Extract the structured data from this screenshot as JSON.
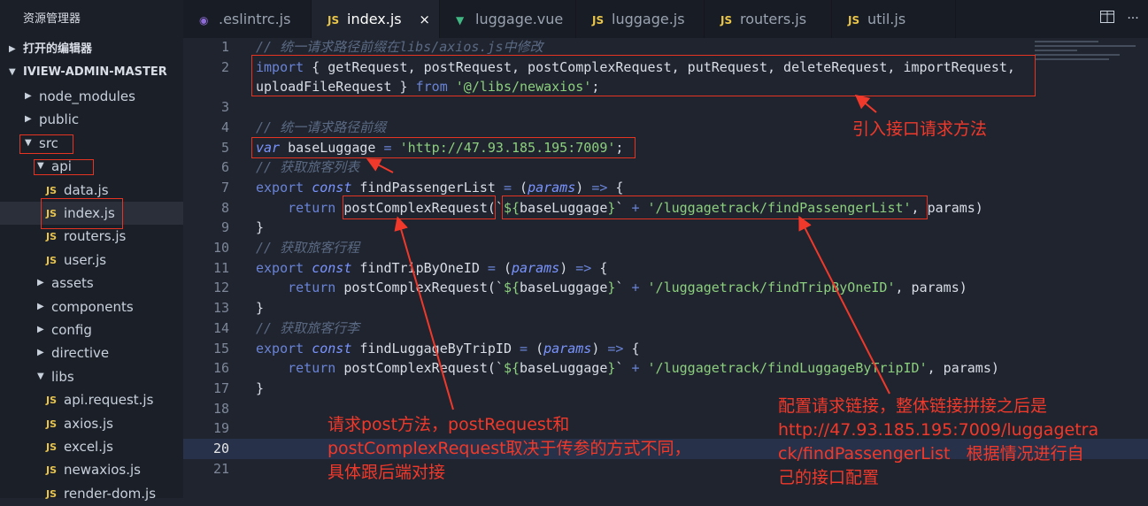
{
  "explorer": {
    "title": "资源管理器",
    "open_editors": "打开的编辑器",
    "project": "IVIEW-ADMIN-MASTER",
    "items": [
      {
        "label": "node_modules",
        "type": "folder",
        "expanded": false,
        "depth": 1
      },
      {
        "label": "public",
        "type": "folder",
        "expanded": false,
        "depth": 1
      },
      {
        "label": "src",
        "type": "folder",
        "expanded": true,
        "depth": 1
      },
      {
        "label": "api",
        "type": "folder",
        "expanded": true,
        "depth": 2
      },
      {
        "label": "data.js",
        "type": "js",
        "depth": 3
      },
      {
        "label": "index.js",
        "type": "js",
        "depth": 3,
        "selected": true
      },
      {
        "label": "routers.js",
        "type": "js",
        "depth": 3
      },
      {
        "label": "user.js",
        "type": "js",
        "depth": 3
      },
      {
        "label": "assets",
        "type": "folder",
        "expanded": false,
        "depth": 2
      },
      {
        "label": "components",
        "type": "folder",
        "expanded": false,
        "depth": 2
      },
      {
        "label": "config",
        "type": "folder",
        "expanded": false,
        "depth": 2
      },
      {
        "label": "directive",
        "type": "folder",
        "expanded": false,
        "depth": 2
      },
      {
        "label": "libs",
        "type": "folder",
        "expanded": true,
        "depth": 2
      },
      {
        "label": "api.request.js",
        "type": "js",
        "depth": 3
      },
      {
        "label": "axios.js",
        "type": "js",
        "depth": 3
      },
      {
        "label": "excel.js",
        "type": "js",
        "depth": 3
      },
      {
        "label": "newaxios.js",
        "type": "js",
        "depth": 3
      },
      {
        "label": "render-dom.js",
        "type": "js",
        "depth": 3
      }
    ]
  },
  "tabs": [
    {
      "label": ".eslintrc.js",
      "icon": "eslint-icon"
    },
    {
      "label": "index.js",
      "icon": "js-icon",
      "active": true
    },
    {
      "label": "luggage.vue",
      "icon": "vue-icon"
    },
    {
      "label": "luggage.js",
      "icon": "js-icon"
    },
    {
      "label": "routers.js",
      "icon": "js-icon"
    },
    {
      "label": "util.js",
      "icon": "js-icon"
    }
  ],
  "js_badge": "JS",
  "close_glyph": "×",
  "current_line": 20,
  "code_lines": [
    {
      "n": "1",
      "tokens": [
        [
          "c",
          "// 统一请求路径前缀在libs/axios.js中修改"
        ]
      ]
    },
    {
      "n": "2",
      "tokens": [
        [
          "k",
          "import"
        ],
        [
          "t",
          " { getRequest, postRequest, postComplexRequest, putRequest, deleteRequest, importRequest,"
        ]
      ]
    },
    {
      "n": "",
      "tokens": [
        [
          "t",
          "uploadFileRequest } "
        ],
        [
          "k",
          "from"
        ],
        [
          "t",
          " "
        ],
        [
          "s",
          "'@/libs/newaxios'"
        ],
        [
          "t",
          ";"
        ]
      ]
    },
    {
      "n": "3",
      "tokens": []
    },
    {
      "n": "4",
      "tokens": [
        [
          "c",
          "// 统一请求路径前缀"
        ]
      ]
    },
    {
      "n": "5",
      "tokens": [
        [
          "p",
          "var"
        ],
        [
          "t",
          " baseLuggage "
        ],
        [
          "op",
          "="
        ],
        [
          "t",
          " "
        ],
        [
          "s",
          "'http://47.93.185.195:7009'"
        ],
        [
          "t",
          ";"
        ]
      ]
    },
    {
      "n": "6",
      "tokens": [
        [
          "c",
          "// 获取旅客列表"
        ]
      ]
    },
    {
      "n": "7",
      "tokens": [
        [
          "k",
          "export"
        ],
        [
          "t",
          " "
        ],
        [
          "p",
          "const"
        ],
        [
          "t",
          " findPassengerList "
        ],
        [
          "op",
          "="
        ],
        [
          "t",
          " ("
        ],
        [
          "p",
          "params"
        ],
        [
          "t",
          ") "
        ],
        [
          "op",
          "=>"
        ],
        [
          "t",
          " {"
        ]
      ]
    },
    {
      "n": "8",
      "tokens": [
        [
          "t",
          "    "
        ],
        [
          "k",
          "return"
        ],
        [
          "t",
          " postComplexRequest(`"
        ],
        [
          "s",
          "${"
        ],
        [
          "t",
          "baseLuggage"
        ],
        [
          "s",
          "}"
        ],
        [
          "t",
          "` "
        ],
        [
          "op",
          "+"
        ],
        [
          "t",
          " "
        ],
        [
          "s",
          "'/luggagetrack/findPassengerList'"
        ],
        [
          "t",
          ", params)"
        ]
      ]
    },
    {
      "n": "9",
      "tokens": [
        [
          "t",
          "}"
        ]
      ]
    },
    {
      "n": "10",
      "tokens": [
        [
          "c",
          "// 获取旅客行程"
        ]
      ]
    },
    {
      "n": "11",
      "tokens": [
        [
          "k",
          "export"
        ],
        [
          "t",
          " "
        ],
        [
          "p",
          "const"
        ],
        [
          "t",
          " findTripByOneID "
        ],
        [
          "op",
          "="
        ],
        [
          "t",
          " ("
        ],
        [
          "p",
          "params"
        ],
        [
          "t",
          ") "
        ],
        [
          "op",
          "=>"
        ],
        [
          "t",
          " {"
        ]
      ]
    },
    {
      "n": "12",
      "tokens": [
        [
          "t",
          "    "
        ],
        [
          "k",
          "return"
        ],
        [
          "t",
          " postComplexRequest(`"
        ],
        [
          "s",
          "${"
        ],
        [
          "t",
          "baseLuggage"
        ],
        [
          "s",
          "}"
        ],
        [
          "t",
          "` "
        ],
        [
          "op",
          "+"
        ],
        [
          "t",
          " "
        ],
        [
          "s",
          "'/luggagetrack/findTripByOneID'"
        ],
        [
          "t",
          ", params)"
        ]
      ]
    },
    {
      "n": "13",
      "tokens": [
        [
          "t",
          "}"
        ]
      ]
    },
    {
      "n": "14",
      "tokens": [
        [
          "c",
          "// 获取旅客行李"
        ]
      ]
    },
    {
      "n": "15",
      "tokens": [
        [
          "k",
          "export"
        ],
        [
          "t",
          " "
        ],
        [
          "p",
          "const"
        ],
        [
          "t",
          " findLuggageByTripID "
        ],
        [
          "op",
          "="
        ],
        [
          "t",
          " ("
        ],
        [
          "p",
          "params"
        ],
        [
          "t",
          ") "
        ],
        [
          "op",
          "=>"
        ],
        [
          "t",
          " {"
        ]
      ]
    },
    {
      "n": "16",
      "tokens": [
        [
          "t",
          "    "
        ],
        [
          "k",
          "return"
        ],
        [
          "t",
          " postComplexRequest(`"
        ],
        [
          "s",
          "${"
        ],
        [
          "t",
          "baseLuggage"
        ],
        [
          "s",
          "}"
        ],
        [
          "t",
          "` "
        ],
        [
          "op",
          "+"
        ],
        [
          "t",
          " "
        ],
        [
          "s",
          "'/luggagetrack/findLuggageByTripID'"
        ],
        [
          "t",
          ", params)"
        ]
      ]
    },
    {
      "n": "17",
      "tokens": [
        [
          "t",
          "}"
        ]
      ]
    },
    {
      "n": "18",
      "tokens": []
    },
    {
      "n": "19",
      "tokens": []
    },
    {
      "n": "20",
      "tokens": []
    },
    {
      "n": "21",
      "tokens": []
    }
  ],
  "annotations": {
    "import_note": "引入接口请求方法",
    "post_note_1": "请求post方法，postRequest和",
    "post_note_2": "postComplexRequest取决于传参的方式不同，",
    "post_note_3": "具体跟后端对接",
    "url_note_1": "配置请求链接，整体链接拼接之后是",
    "url_note_2": "http://47.93.185.195:7009/luggagetra",
    "url_note_3": "ck/findPassengerList   根据情况进行自",
    "url_note_4": "己的接口配置"
  },
  "colors": {
    "annotation": "#f0392b",
    "keyword": "#6a83d6",
    "string": "#8ccf7e",
    "comment": "#5b6a84",
    "js_badge": "#e9c54b",
    "vue_icon": "#41b883",
    "eslint_icon": "#8e6bd8"
  }
}
